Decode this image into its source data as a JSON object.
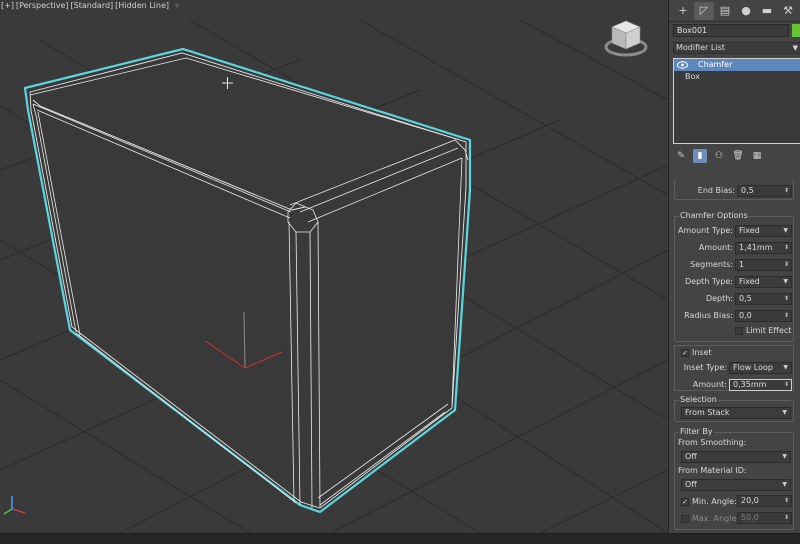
{
  "viewport": {
    "labels": [
      "[+]",
      "[Perspective]",
      "[Standard]",
      "[Hidden Line]"
    ]
  },
  "command_panel": {
    "tabs": [
      {
        "icon": "create-plus-icon",
        "glyph": "+"
      },
      {
        "icon": "modify-icon",
        "glyph": "◸"
      },
      {
        "icon": "hierarchy-icon",
        "glyph": "▤"
      },
      {
        "icon": "motion-icon",
        "glyph": "●"
      },
      {
        "icon": "display-icon",
        "glyph": "▬"
      },
      {
        "icon": "utilities-icon",
        "glyph": "⚒"
      }
    ],
    "object_name": "Box001",
    "color": "#66c432",
    "modifier_list_label": "Modifier List",
    "stack": [
      {
        "label": "Chamfer",
        "selected": true
      },
      {
        "label": "Box",
        "selected": false
      }
    ]
  },
  "rollout": {
    "end_bias": {
      "label": "End Bias:",
      "value": "0,5"
    },
    "chamfer_options": {
      "title": "Chamfer Options",
      "amount_type": {
        "label": "Amount Type:",
        "value": "Fixed"
      },
      "amount": {
        "label": "Amount:",
        "value": "1,41mm"
      },
      "segments": {
        "label": "Segments:",
        "value": "1"
      },
      "depth_type": {
        "label": "Depth Type:",
        "value": "Fixed"
      },
      "depth": {
        "label": "Depth:",
        "value": "0,5"
      },
      "radius_bias": {
        "label": "Radius Bias:",
        "value": "0,0"
      },
      "limit_effect": {
        "label": "Limit Effect",
        "checked": false
      }
    },
    "inset": {
      "label": "Inset",
      "checked": true,
      "inset_type": {
        "label": "Inset Type:",
        "value": "Flow Loop"
      },
      "amount": {
        "label": "Amount:",
        "value": "0,35mm"
      }
    },
    "selection": {
      "title": "Selection",
      "value": "From Stack"
    },
    "filter_by": {
      "title": "Filter By",
      "from_smoothing": {
        "label": "From Smoothing:",
        "value": "Off"
      },
      "from_material_id": {
        "label": "From Material ID:",
        "value": "Off"
      },
      "min_angle": {
        "label": "Min. Angle:",
        "value": "20,0",
        "checked": true
      },
      "max_angle": {
        "label": "Max. Angle:",
        "value": "50,0",
        "checked": false
      }
    }
  }
}
